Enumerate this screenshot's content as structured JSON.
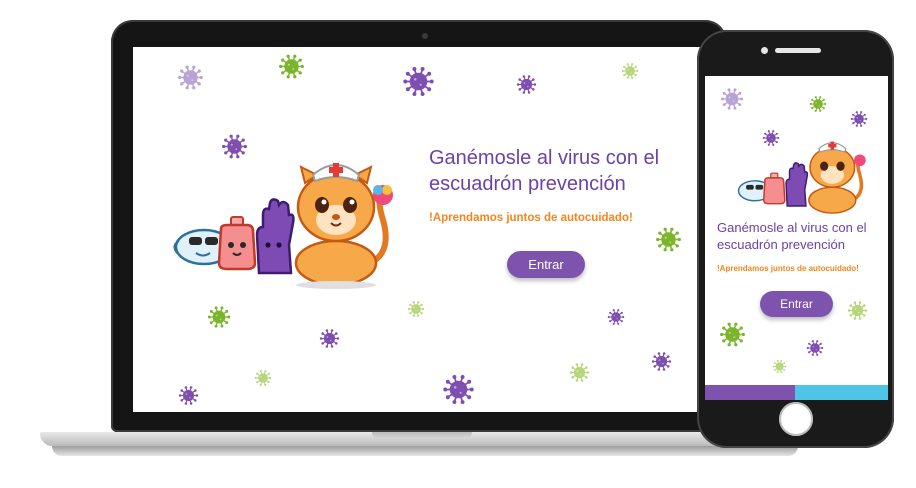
{
  "desktop": {
    "headline": "Ganémosle al virus con el escuadrón prevención",
    "subtitle": "!Aprendamos juntos de autocuidado!",
    "button_label": "Entrar"
  },
  "mobile": {
    "headline": "Ganémosle al virus con el escuadrón prevención",
    "subtitle": "!Aprendamos juntos de autocuidado!",
    "button_label": "Entrar",
    "footer_colors": [
      "#7e53ae",
      "#4ec4e6"
    ]
  },
  "colors": {
    "purple_text": "#6b42a6",
    "orange_text": "#f3861d",
    "button": "#7e53ae",
    "virus_purple": "#7e4fb0",
    "virus_light_purple": "#b9a2d6",
    "virus_green": "#7ab52a",
    "virus_light_green": "#b6d67a"
  },
  "icons": [
    "virus-icon",
    "lion-mascot-icon",
    "face-mask-icon",
    "sanitizer-icon",
    "glove-icon"
  ]
}
